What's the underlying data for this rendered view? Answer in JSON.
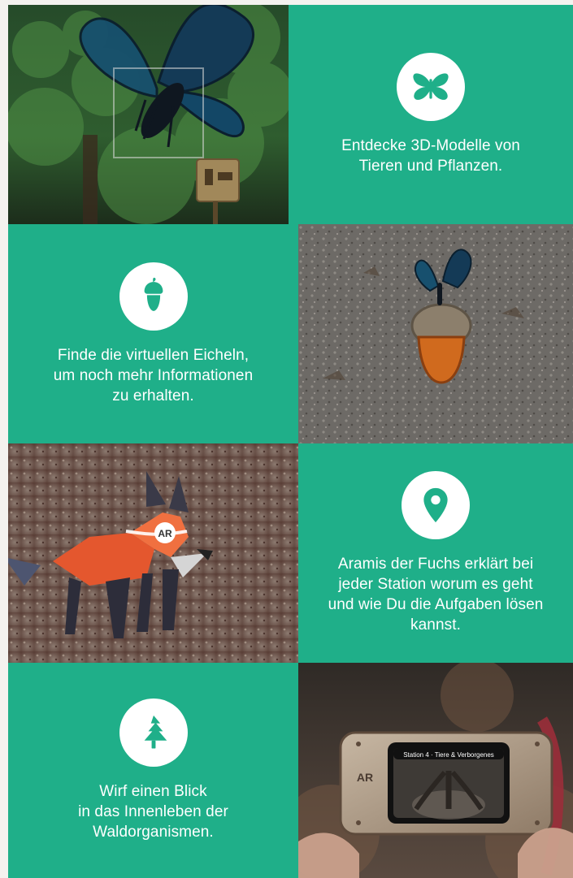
{
  "colors": {
    "green": "#1faf89",
    "page_bg": "#f4f2ef"
  },
  "tiles": [
    {
      "type": "photo",
      "name": "butterfly-forest-photo",
      "badge_text": ""
    },
    {
      "type": "feature",
      "icon": "butterfly-icon",
      "lines": [
        "Entdecke 3D-Modelle von",
        "Tieren und Pflanzen."
      ]
    },
    {
      "type": "feature",
      "icon": "acorn-icon",
      "lines": [
        "Finde die virtuellen Eicheln,",
        "um noch mehr Informationen",
        "zu erhalten."
      ]
    },
    {
      "type": "photo",
      "name": "acorn-butterfly-ground-photo",
      "badge_text": ""
    },
    {
      "type": "photo",
      "name": "fox-ar-photo",
      "badge_text": "AR"
    },
    {
      "type": "feature",
      "icon": "map-pin-icon",
      "lines": [
        "Aramis der Fuchs erklärt bei",
        "jeder Station worum es geht",
        "und wie Du die Aufgaben lösen",
        "kannst."
      ]
    },
    {
      "type": "feature",
      "icon": "tree-icon",
      "lines": [
        "Wirf einen Blick",
        "in das Innenleben der",
        "Waldorganismen."
      ]
    },
    {
      "type": "photo",
      "name": "device-hands-photo",
      "badge_text": "AR",
      "screen_title": "Station 4 · Tiere & Verborgenes"
    }
  ]
}
